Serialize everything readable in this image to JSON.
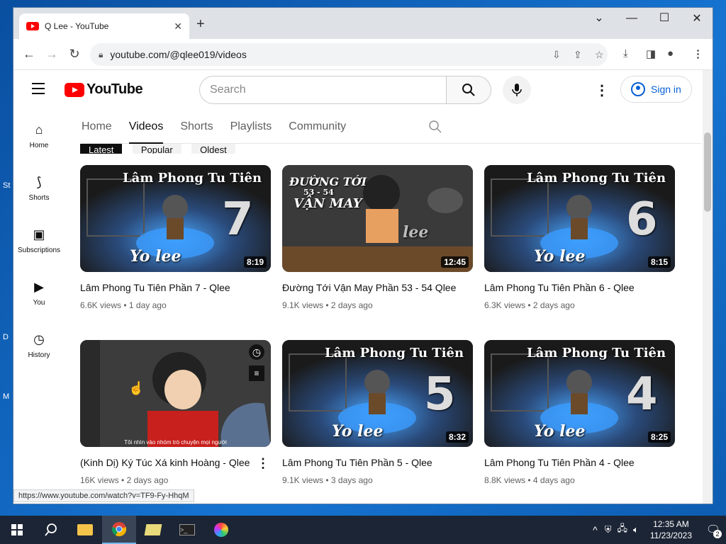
{
  "desktop": {
    "chars": [
      "St",
      "D",
      "M"
    ]
  },
  "browser": {
    "tab_title": "Q Lee - YouTube",
    "tab_close": "✕",
    "new_tab": "+",
    "window_controls": {
      "chevron": "⌄",
      "minimize": "—",
      "maximize": "☐",
      "close": "✕"
    },
    "url": "youtube.com/@qlee019/videos",
    "status_url": "https://www.youtube.com/watch?v=TF9-Fy-HhqM"
  },
  "youtube": {
    "logo_text": "YouTube",
    "search_placeholder": "Search",
    "sign_in": "Sign in",
    "sidebar": [
      {
        "label": "Home",
        "icon": "⌂",
        "name": "home"
      },
      {
        "label": "Shorts",
        "icon": "⟆",
        "name": "shorts"
      },
      {
        "label": "Subscriptions",
        "icon": "▣",
        "name": "subscriptions"
      },
      {
        "label": "You",
        "icon": "▶",
        "name": "you"
      },
      {
        "label": "History",
        "icon": "◷",
        "name": "history"
      }
    ],
    "channel_tabs": [
      "Home",
      "Videos",
      "Shorts",
      "Playlists",
      "Community"
    ],
    "active_tab": "Videos",
    "chips": [
      "Latest",
      "Popular",
      "Oldest"
    ],
    "videos": [
      {
        "title": "Lâm Phong Tu Tiên Phần 7 - Qlee",
        "views": "6.6K views",
        "age": "1 day ago",
        "duration": "8:19",
        "thumb_title": "Lâm Phong Tu Tiên",
        "thumb_num": "7",
        "thumb_brand": "Yo   lee"
      },
      {
        "title": "Đường Tới Vận May Phần 53 - 54 Qlee",
        "views": "9.1K views",
        "age": "2 days ago",
        "duration": "12:45",
        "thumb_title": "ĐƯỜNG TỚI",
        "thumb_sub": "53 - 54",
        "thumb_sub2": "VẬN MAY",
        "thumb_brand": "lee"
      },
      {
        "title": "Lâm Phong Tu Tiên Phần 6 - Qlee",
        "views": "6.3K views",
        "age": "2 days ago",
        "duration": "8:15",
        "thumb_title": "Lâm Phong Tu Tiên",
        "thumb_num": "6",
        "thumb_brand": "Yo   lee"
      },
      {
        "title": "(Kinh Dị) Ký Túc Xá kinh Hoàng - Qlee",
        "views": "16K views",
        "age": "2 days ago",
        "duration": "",
        "thumb_caption": "Tôi nhìn vào nhóm trò chuyện mọi người"
      },
      {
        "title": "Lâm Phong Tu Tiên Phần 5 - Qlee",
        "views": "9.1K views",
        "age": "3 days ago",
        "duration": "8:32",
        "thumb_title": "Lâm Phong Tu Tiên",
        "thumb_num": "5",
        "thumb_brand": "Yo   lee"
      },
      {
        "title": "Lâm Phong Tu Tiên Phần 4 - Qlee",
        "views": "8.8K views",
        "age": "4 days ago",
        "duration": "8:25",
        "thumb_title": "Lâm Phong Tu Tiên",
        "thumb_num": "4",
        "thumb_brand": "Yo   lee"
      }
    ]
  },
  "taskbar": {
    "time": "12:35 AM",
    "date": "11/23/2023",
    "notif_count": "2"
  }
}
